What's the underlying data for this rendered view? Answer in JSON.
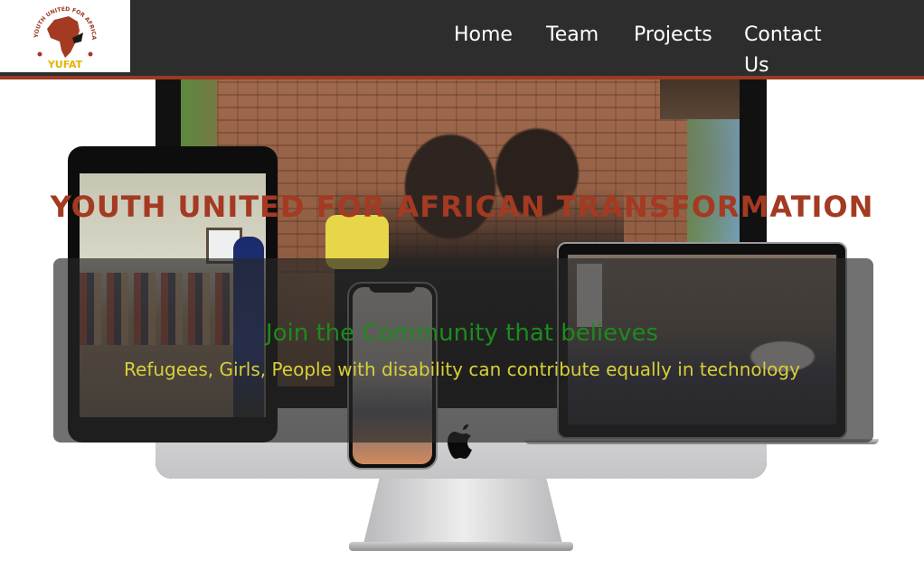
{
  "header": {
    "logo": {
      "alt": "YUFAT",
      "ring_text": "YOUTH UNITED FOR AFRICAN TRANSFORMATION",
      "word": "YUFAT"
    },
    "nav": [
      {
        "label": "Home"
      },
      {
        "label": "Team"
      },
      {
        "label": "Projects"
      },
      {
        "label": "Contact Us"
      }
    ]
  },
  "hero": {
    "title": "YOUTH UNITED FOR AFRICAN TRANSFORMATION",
    "tagline": "Join the Community that believes",
    "subtagline": "Refugees, Girls, People with disability can contribute equally in technology"
  },
  "colors": {
    "header_bg": "#2d2d2d",
    "accent_line": "#9b3a22",
    "title": "#a43a22",
    "tagline": "#1d8a1d",
    "subtagline": "#d8cf3a"
  }
}
